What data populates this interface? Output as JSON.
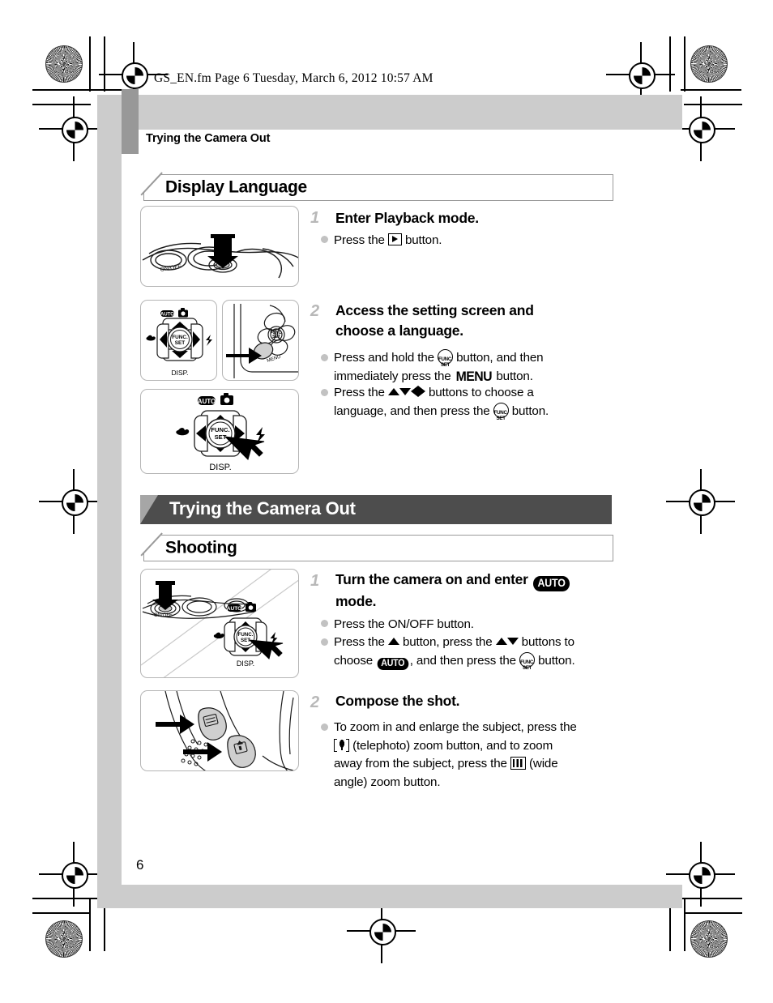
{
  "print_header": {
    "filename": "GS_EN.fm",
    "page_label": "Page 6",
    "timestamp": "Tuesday, March 6, 2012  10:57 AM",
    "full_line": "GS_EN.fm  Page 6  Tuesday, March 6, 2012  10:57 AM"
  },
  "running_head": "Trying the Camera Out",
  "page_number": "6",
  "colors": {
    "band_gray": "#cccccc",
    "tab_gray": "#989898",
    "chapter_bar": "#4d4d4d",
    "chapter_bar_triangle": "#a6a6a6",
    "section_box_border": "#9a9a9a",
    "step_number": "#b8b8b8",
    "bullet": "#c2c2c2",
    "illustration_border": "#b5b5b5"
  },
  "sections": [
    {
      "id": "display-language",
      "heading": "Display Language",
      "steps": [
        {
          "number": "1",
          "title": "Enter Playback mode.",
          "bullets": [
            [
              {
                "t": "text",
                "v": "Press the "
              },
              {
                "t": "icon",
                "v": "playback-icon"
              },
              {
                "t": "text",
                "v": " button."
              }
            ]
          ]
        },
        {
          "number": "2",
          "title_lines": [
            "Access the setting screen and",
            "choose a language."
          ],
          "bullets": [
            [
              {
                "t": "text",
                "v": "Press and hold the "
              },
              {
                "t": "icon",
                "v": "func-set-icon"
              },
              {
                "t": "text",
                "v": " button, and then immediately press the "
              },
              {
                "t": "icon",
                "v": "menu-icon"
              },
              {
                "t": "text",
                "v": " button."
              }
            ],
            [
              {
                "t": "text",
                "v": "Press the "
              },
              {
                "t": "icon",
                "v": "up-arrow-icon"
              },
              {
                "t": "icon",
                "v": "down-arrow-icon"
              },
              {
                "t": "icon",
                "v": "left-arrow-icon"
              },
              {
                "t": "icon",
                "v": "right-arrow-icon"
              },
              {
                "t": "text",
                "v": " buttons to choose a language, and then press the "
              },
              {
                "t": "icon",
                "v": "func-set-icon"
              },
              {
                "t": "text",
                "v": " button."
              }
            ]
          ]
        }
      ]
    },
    {
      "id": "shooting",
      "chapter_banner": "Trying the Camera Out",
      "heading": "Shooting",
      "steps": [
        {
          "number": "1",
          "title_lines": [
            "Turn the camera on and enter AUTO",
            "mode."
          ],
          "bullets": [
            [
              {
                "t": "text",
                "v": "Press the ON/OFF button."
              }
            ],
            [
              {
                "t": "text",
                "v": "Press the "
              },
              {
                "t": "icon",
                "v": "up-arrow-icon"
              },
              {
                "t": "text",
                "v": " button, press the "
              },
              {
                "t": "icon",
                "v": "up-arrow-icon"
              },
              {
                "t": "icon",
                "v": "down-arrow-icon"
              },
              {
                "t": "text",
                "v": " buttons to choose "
              },
              {
                "t": "icon",
                "v": "auto-mode-icon"
              },
              {
                "t": "text",
                "v": ", and then press the "
              },
              {
                "t": "icon",
                "v": "func-set-icon"
              },
              {
                "t": "text",
                "v": " button."
              }
            ]
          ]
        },
        {
          "number": "2",
          "title": "Compose the shot.",
          "bullets": [
            [
              {
                "t": "text",
                "v": "To zoom in and enlarge the subject, press the "
              },
              {
                "t": "icon",
                "v": "telephoto-zoom-icon"
              },
              {
                "t": "text",
                "v": " (telephoto) zoom button, and to zoom away from the subject, press the "
              },
              {
                "t": "icon",
                "v": "wide-angle-zoom-icon"
              },
              {
                "t": "text",
                "v": " (wide angle) zoom button."
              }
            ]
          ]
        }
      ]
    }
  ],
  "illustration_labels": {
    "auto": "AUTO",
    "func": "FUNC.",
    "set": "SET",
    "disp": "DISP.",
    "menu": "MENU",
    "onoff": "ON/OFF"
  },
  "step_titles": {
    "s1_title": "Enter Playback mode.",
    "s2_line1": "Access the setting screen and",
    "s2_line2": "choose a language.",
    "t1_line1_a": "Turn the camera on and enter ",
    "t1_line2": "mode.",
    "t2_title": "Compose the shot."
  },
  "body_strings": {
    "press_the": "Press the ",
    "button_period": " button.",
    "press_hold": "Press and hold the ",
    "then_immediately": " button, and then",
    "immediately_press": "immediately press the ",
    "press_the2": "Press the ",
    "buttons_choose": " buttons to choose a",
    "language_then": "language, and then press the ",
    "onoff_button": "Press the ON/OFF button.",
    "press_up_a": "Press the ",
    "button_press_the": " button, press the ",
    "buttons_to": " buttons to",
    "choose": "choose ",
    "and_then_press": ", and then press the ",
    "zoom_l1": "To zoom in and enlarge the subject, press the",
    "zoom_l2a": " (telephoto) zoom button, and to zoom",
    "zoom_l3a": "away from the subject, press the ",
    "zoom_l3b": " (wide",
    "zoom_l4": "angle) zoom button."
  }
}
